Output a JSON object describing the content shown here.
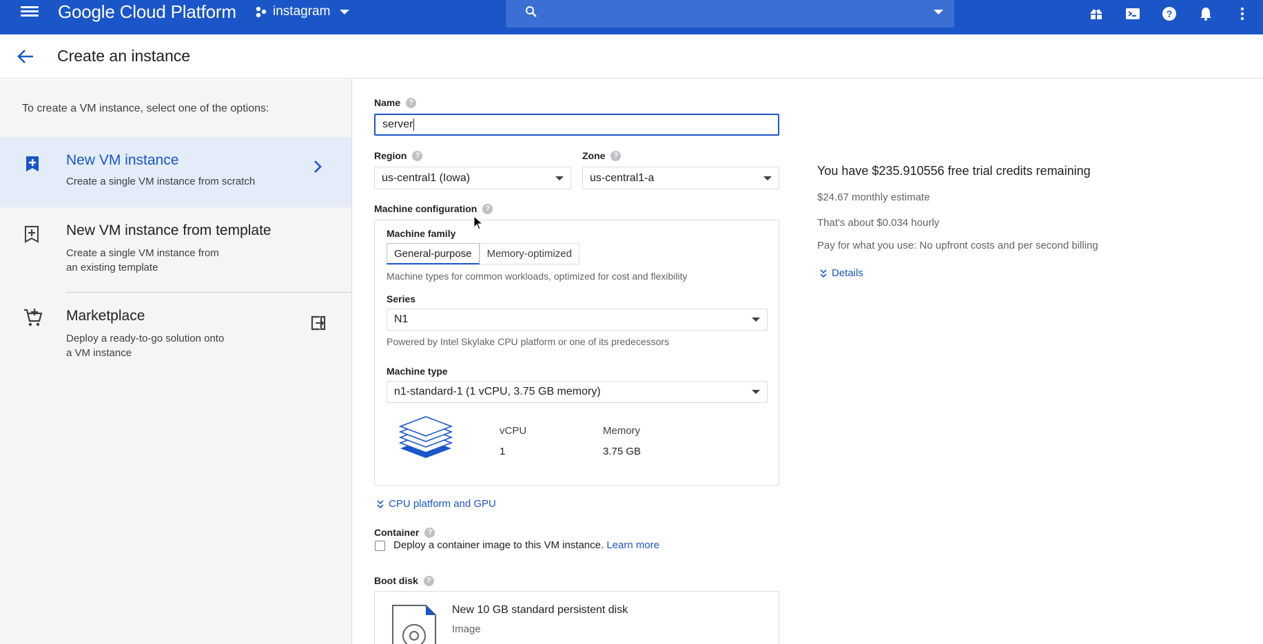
{
  "topbar": {
    "brand": "Google Cloud Platform",
    "project": "instagram",
    "icons": [
      "menu-icon",
      "project-icon",
      "search-icon",
      "gift-icon",
      "cloud-shell-icon",
      "help-icon",
      "notifications-icon",
      "more-vert-icon"
    ]
  },
  "subheader": {
    "title": "Create an instance"
  },
  "left": {
    "intro": "To create a VM instance, select one of the options:",
    "options": [
      {
        "title": "New VM instance",
        "desc_lines": [
          "Create a single VM instance from scratch"
        ]
      },
      {
        "title": "New VM instance from template",
        "desc_lines": [
          "Create a single VM instance from",
          "an existing template"
        ]
      },
      {
        "title": "Marketplace",
        "desc_lines": [
          "Deploy a ready-to-go solution onto",
          "a VM instance"
        ]
      }
    ]
  },
  "form": {
    "name_label": "Name",
    "name_value": "server",
    "region_label": "Region",
    "region_value": "us-central1 (Iowa)",
    "zone_label": "Zone",
    "zone_value": "us-central1-a",
    "machine_config_label": "Machine configuration",
    "machine_family_label": "Machine family",
    "families": [
      "General-purpose",
      "Memory-optimized"
    ],
    "family_hint": "Machine types for common workloads, optimized for cost and flexibility",
    "series_label": "Series",
    "series_value": "N1",
    "series_hint": "Powered by Intel Skylake CPU platform or one of its predecessors",
    "machine_type_label": "Machine type",
    "machine_type_value": "n1-standard-1 (1 vCPU, 3.75 GB memory)",
    "vcpu_label": "vCPU",
    "vcpu_value": "1",
    "memory_label": "Memory",
    "memory_value": "3.75 GB",
    "cpu_gpu_link": "CPU platform and GPU",
    "container_label": "Container",
    "container_checkbox_text": "Deploy a container image to this VM instance.",
    "learn_more": "Learn more",
    "boot_disk_label": "Boot disk",
    "boot_disk_title": "New 10 GB standard persistent disk",
    "boot_disk_image": "Image"
  },
  "pricing": {
    "credits": "You have $235.910556 free trial credits remaining",
    "monthly": "$24.67 monthly estimate",
    "hourly": "That's about $0.034 hourly",
    "billing": "Pay for what you use: No upfront costs and per second billing",
    "details": "Details"
  },
  "colors": {
    "brand_blue": "#1a56c8",
    "selected_bg": "#e3ecf8"
  }
}
